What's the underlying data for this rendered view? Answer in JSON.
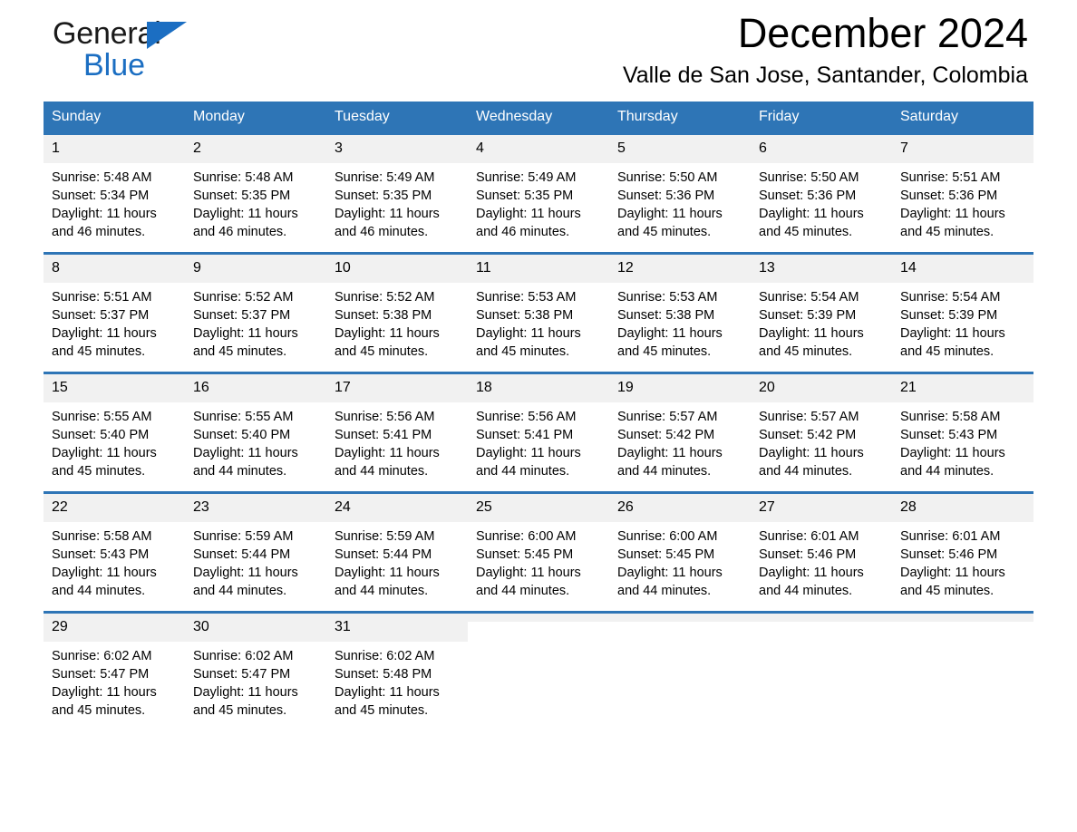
{
  "brand": {
    "name_part1": "General",
    "name_part2": "Blue",
    "triangle_color": "#1b6ec2"
  },
  "header": {
    "month_title": "December 2024",
    "location": "Valle de San Jose, Santander, Colombia"
  },
  "theme": {
    "header_blue": "#2e75b6",
    "day_band_gray": "#f1f1f1",
    "text_black": "#000000",
    "header_text": "#ffffff"
  },
  "weekday_headers": [
    "Sunday",
    "Monday",
    "Tuesday",
    "Wednesday",
    "Thursday",
    "Friday",
    "Saturday"
  ],
  "labels": {
    "sunrise_prefix": "Sunrise:",
    "sunset_prefix": "Sunset:",
    "daylight_prefix": "Daylight:"
  },
  "weeks": [
    [
      {
        "day": "1",
        "sunrise": "Sunrise: 5:48 AM",
        "sunset": "Sunset: 5:34 PM",
        "daylight": "Daylight: 11 hours and 46 minutes."
      },
      {
        "day": "2",
        "sunrise": "Sunrise: 5:48 AM",
        "sunset": "Sunset: 5:35 PM",
        "daylight": "Daylight: 11 hours and 46 minutes."
      },
      {
        "day": "3",
        "sunrise": "Sunrise: 5:49 AM",
        "sunset": "Sunset: 5:35 PM",
        "daylight": "Daylight: 11 hours and 46 minutes."
      },
      {
        "day": "4",
        "sunrise": "Sunrise: 5:49 AM",
        "sunset": "Sunset: 5:35 PM",
        "daylight": "Daylight: 11 hours and 46 minutes."
      },
      {
        "day": "5",
        "sunrise": "Sunrise: 5:50 AM",
        "sunset": "Sunset: 5:36 PM",
        "daylight": "Daylight: 11 hours and 45 minutes."
      },
      {
        "day": "6",
        "sunrise": "Sunrise: 5:50 AM",
        "sunset": "Sunset: 5:36 PM",
        "daylight": "Daylight: 11 hours and 45 minutes."
      },
      {
        "day": "7",
        "sunrise": "Sunrise: 5:51 AM",
        "sunset": "Sunset: 5:36 PM",
        "daylight": "Daylight: 11 hours and 45 minutes."
      }
    ],
    [
      {
        "day": "8",
        "sunrise": "Sunrise: 5:51 AM",
        "sunset": "Sunset: 5:37 PM",
        "daylight": "Daylight: 11 hours and 45 minutes."
      },
      {
        "day": "9",
        "sunrise": "Sunrise: 5:52 AM",
        "sunset": "Sunset: 5:37 PM",
        "daylight": "Daylight: 11 hours and 45 minutes."
      },
      {
        "day": "10",
        "sunrise": "Sunrise: 5:52 AM",
        "sunset": "Sunset: 5:38 PM",
        "daylight": "Daylight: 11 hours and 45 minutes."
      },
      {
        "day": "11",
        "sunrise": "Sunrise: 5:53 AM",
        "sunset": "Sunset: 5:38 PM",
        "daylight": "Daylight: 11 hours and 45 minutes."
      },
      {
        "day": "12",
        "sunrise": "Sunrise: 5:53 AM",
        "sunset": "Sunset: 5:38 PM",
        "daylight": "Daylight: 11 hours and 45 minutes."
      },
      {
        "day": "13",
        "sunrise": "Sunrise: 5:54 AM",
        "sunset": "Sunset: 5:39 PM",
        "daylight": "Daylight: 11 hours and 45 minutes."
      },
      {
        "day": "14",
        "sunrise": "Sunrise: 5:54 AM",
        "sunset": "Sunset: 5:39 PM",
        "daylight": "Daylight: 11 hours and 45 minutes."
      }
    ],
    [
      {
        "day": "15",
        "sunrise": "Sunrise: 5:55 AM",
        "sunset": "Sunset: 5:40 PM",
        "daylight": "Daylight: 11 hours and 45 minutes."
      },
      {
        "day": "16",
        "sunrise": "Sunrise: 5:55 AM",
        "sunset": "Sunset: 5:40 PM",
        "daylight": "Daylight: 11 hours and 44 minutes."
      },
      {
        "day": "17",
        "sunrise": "Sunrise: 5:56 AM",
        "sunset": "Sunset: 5:41 PM",
        "daylight": "Daylight: 11 hours and 44 minutes."
      },
      {
        "day": "18",
        "sunrise": "Sunrise: 5:56 AM",
        "sunset": "Sunset: 5:41 PM",
        "daylight": "Daylight: 11 hours and 44 minutes."
      },
      {
        "day": "19",
        "sunrise": "Sunrise: 5:57 AM",
        "sunset": "Sunset: 5:42 PM",
        "daylight": "Daylight: 11 hours and 44 minutes."
      },
      {
        "day": "20",
        "sunrise": "Sunrise: 5:57 AM",
        "sunset": "Sunset: 5:42 PM",
        "daylight": "Daylight: 11 hours and 44 minutes."
      },
      {
        "day": "21",
        "sunrise": "Sunrise: 5:58 AM",
        "sunset": "Sunset: 5:43 PM",
        "daylight": "Daylight: 11 hours and 44 minutes."
      }
    ],
    [
      {
        "day": "22",
        "sunrise": "Sunrise: 5:58 AM",
        "sunset": "Sunset: 5:43 PM",
        "daylight": "Daylight: 11 hours and 44 minutes."
      },
      {
        "day": "23",
        "sunrise": "Sunrise: 5:59 AM",
        "sunset": "Sunset: 5:44 PM",
        "daylight": "Daylight: 11 hours and 44 minutes."
      },
      {
        "day": "24",
        "sunrise": "Sunrise: 5:59 AM",
        "sunset": "Sunset: 5:44 PM",
        "daylight": "Daylight: 11 hours and 44 minutes."
      },
      {
        "day": "25",
        "sunrise": "Sunrise: 6:00 AM",
        "sunset": "Sunset: 5:45 PM",
        "daylight": "Daylight: 11 hours and 44 minutes."
      },
      {
        "day": "26",
        "sunrise": "Sunrise: 6:00 AM",
        "sunset": "Sunset: 5:45 PM",
        "daylight": "Daylight: 11 hours and 44 minutes."
      },
      {
        "day": "27",
        "sunrise": "Sunrise: 6:01 AM",
        "sunset": "Sunset: 5:46 PM",
        "daylight": "Daylight: 11 hours and 44 minutes."
      },
      {
        "day": "28",
        "sunrise": "Sunrise: 6:01 AM",
        "sunset": "Sunset: 5:46 PM",
        "daylight": "Daylight: 11 hours and 45 minutes."
      }
    ],
    [
      {
        "day": "29",
        "sunrise": "Sunrise: 6:02 AM",
        "sunset": "Sunset: 5:47 PM",
        "daylight": "Daylight: 11 hours and 45 minutes."
      },
      {
        "day": "30",
        "sunrise": "Sunrise: 6:02 AM",
        "sunset": "Sunset: 5:47 PM",
        "daylight": "Daylight: 11 hours and 45 minutes."
      },
      {
        "day": "31",
        "sunrise": "Sunrise: 6:02 AM",
        "sunset": "Sunset: 5:48 PM",
        "daylight": "Daylight: 11 hours and 45 minutes."
      },
      {
        "day": "",
        "sunrise": "",
        "sunset": "",
        "daylight": ""
      },
      {
        "day": "",
        "sunrise": "",
        "sunset": "",
        "daylight": ""
      },
      {
        "day": "",
        "sunrise": "",
        "sunset": "",
        "daylight": ""
      },
      {
        "day": "",
        "sunrise": "",
        "sunset": "",
        "daylight": ""
      }
    ]
  ]
}
